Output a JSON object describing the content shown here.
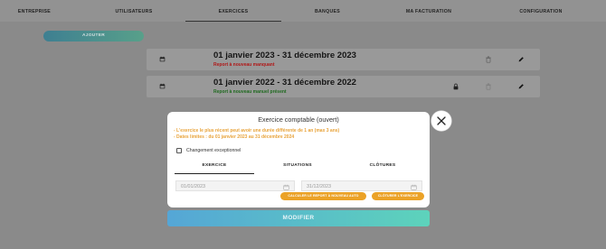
{
  "nav": {
    "tabs": [
      "ENTREPRISE",
      "UTILISATEURS",
      "EXERCICES",
      "BANQUES",
      "MA FACTURATION",
      "CONFIGURATION"
    ],
    "active": "EXERCICES"
  },
  "toolbar": {
    "add_label": "AJOUTER"
  },
  "exercises": [
    {
      "title": "01 janvier 2023 - 31 décembre 2023",
      "status": "Report à nouveau manquant",
      "status_color": "#b01818"
    },
    {
      "title": "01 janvier 2022 - 31 décembre 2022",
      "status": "Report à nouveau manuel présent",
      "status_color": "#1f6a1f"
    }
  ],
  "modal": {
    "title": "Exercice comptable (ouvert)",
    "notes": [
      "- L'exercice le plus récent peut avoir une durée différente de 1 an (max 3 ans)",
      "- Dates limites : du 01 janvier 2023 au 31 décembre 2024"
    ],
    "checkbox_label": "Changement exceptionnel",
    "tabs": [
      "EXERCICE",
      "SITUATIONS",
      "CLÔTURES"
    ],
    "active_tab": "EXERCICE",
    "start_date": "01/01/2023",
    "end_date": "31/12/2023",
    "calc_button": "CALCULER LE REPORT À NOUVEAU AUTO",
    "close_exercise_button": "CLÔTURER L'EXERCICE",
    "modify_button": "MODIFIER"
  },
  "colors": {
    "accent_orange": "#eba227",
    "nav_bg": "#929292"
  }
}
